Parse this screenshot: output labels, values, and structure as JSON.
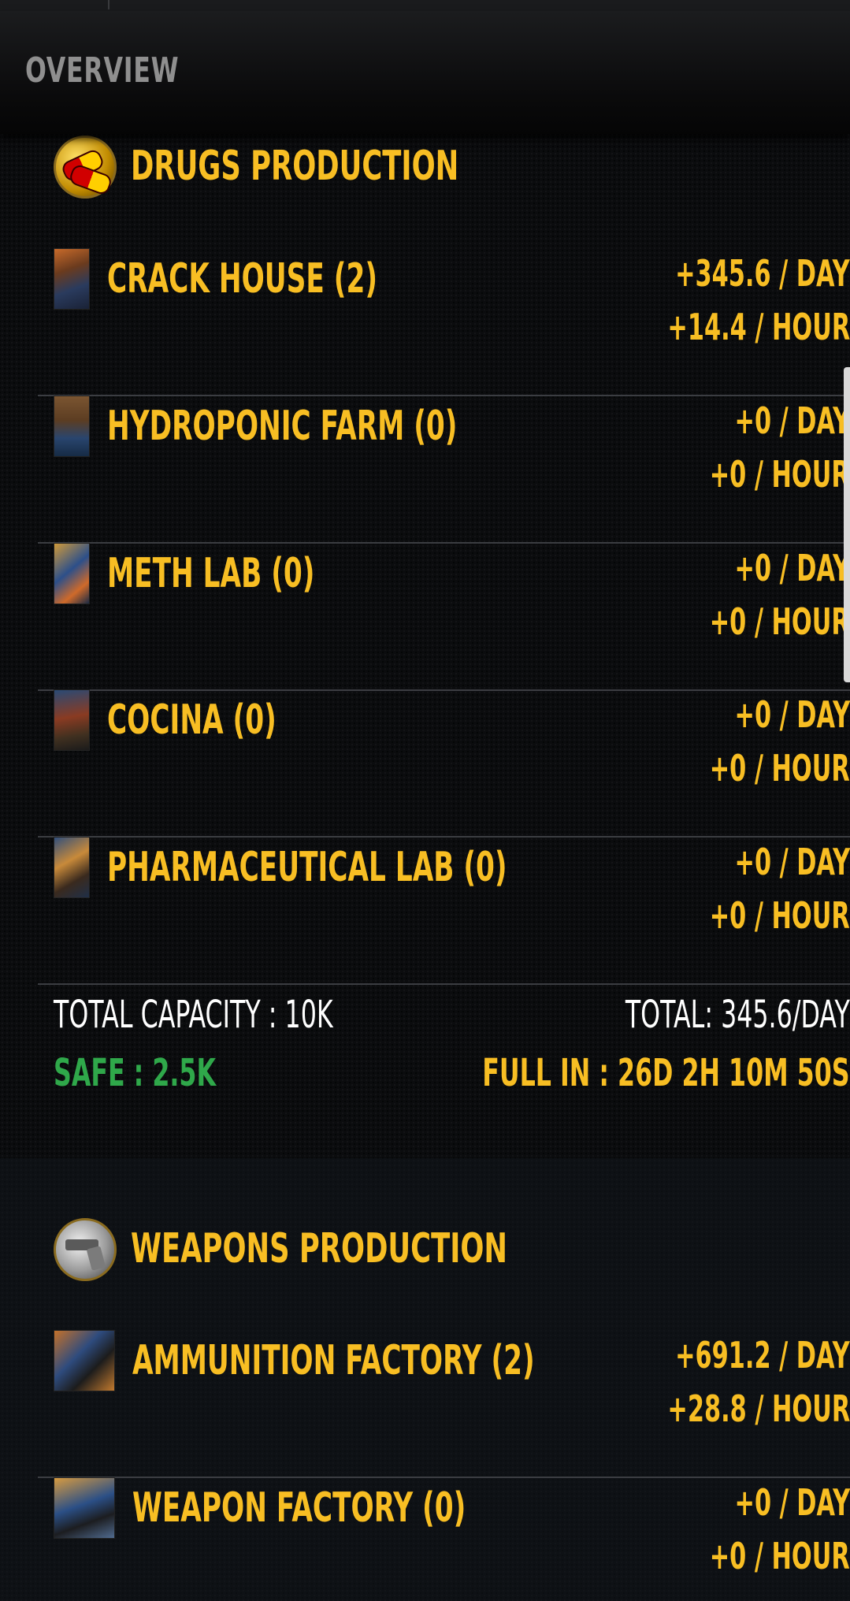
{
  "header": {
    "title": "OVERVIEW"
  },
  "drugs": {
    "section_title": "DRUGS PRODUCTION",
    "section_icon": "pills-icon",
    "items": [
      {
        "name": "CRACK HOUSE (2)",
        "per_day": "+345.6 / DAY",
        "per_hour": "+14.4 / HOUR",
        "thumb": "crack-house-thumbnail"
      },
      {
        "name": "HYDROPONIC FARM (0)",
        "per_day": "+0 / DAY",
        "per_hour": "+0 / HOUR",
        "thumb": "hydroponic-farm-thumbnail"
      },
      {
        "name": "METH LAB (0)",
        "per_day": "+0 / DAY",
        "per_hour": "+0 / HOUR",
        "thumb": "meth-lab-thumbnail"
      },
      {
        "name": "COCINA (0)",
        "per_day": "+0 / DAY",
        "per_hour": "+0 / HOUR",
        "thumb": "cocina-thumbnail"
      },
      {
        "name": "PHARMACEUTICAL LAB (0)",
        "per_day": "+0 / DAY",
        "per_hour": "+0 / HOUR",
        "thumb": "pharmaceutical-lab-thumbnail"
      }
    ],
    "totals": {
      "capacity": "TOTAL CAPACITY : 10K",
      "total": "TOTAL: 345.6/DAY",
      "safe": "SAFE : 2.5K",
      "full_in": "FULL IN : 26D 2H 10M 50S"
    }
  },
  "weapons": {
    "section_title": "WEAPONS PRODUCTION",
    "section_icon": "revolver-icon",
    "items": [
      {
        "name": "AMMUNITION FACTORY (2)",
        "per_day": "+691.2 / DAY",
        "per_hour": "+28.8 / HOUR",
        "thumb": "ammunition-factory-thumbnail"
      },
      {
        "name": "WEAPON FACTORY (0)",
        "per_day": "+0 / DAY",
        "per_hour": "+0 / HOUR",
        "thumb": "weapon-factory-thumbnail"
      }
    ]
  },
  "colors": {
    "accent_yellow": "#f8be23",
    "safe_green": "#2fa84a",
    "header_gray": "#8f8f8f",
    "background": "#0b0c0e"
  }
}
